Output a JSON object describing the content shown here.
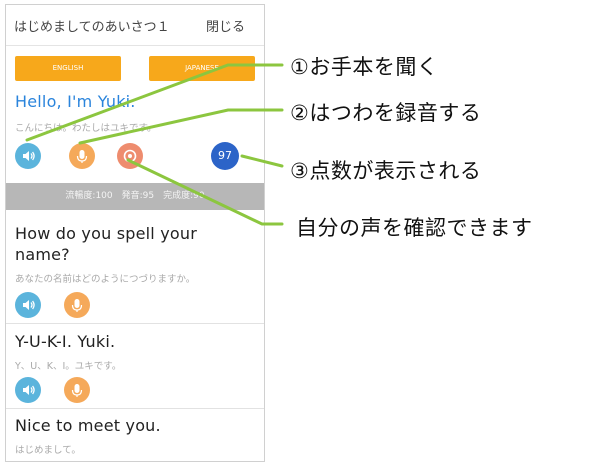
{
  "header": {
    "title": "はじめましてのあいさつ１",
    "close_label": "閉じる"
  },
  "language_buttons": {
    "english": "ENGLISH",
    "japanese": "JAPANESE"
  },
  "lines": [
    {
      "en": "Hello, I'm Yuki.",
      "jp": "こんにちは。わたしはユキです。"
    },
    {
      "en1": "How do you spell your",
      "en2": "name?",
      "jp": "あなたの名前はどのようにつづりますか。"
    },
    {
      "en": "Y-U-K-I. Yuki.",
      "jp": "Y、U、K、I。ユキです。"
    },
    {
      "en": "Nice to meet you.",
      "jp": "はじめまして。"
    }
  ],
  "score": {
    "value": "97"
  },
  "score_bar": {
    "text": "流暢度:100　発音:95　完成度:90"
  },
  "icons": {
    "listen": "speaker-icon",
    "record": "microphone-icon",
    "playback": "replay-icon"
  },
  "colors": {
    "accent": "#f7a81b",
    "highlight_text": "#2a84dc",
    "listen_button": "#5bb4dc",
    "record_button": "#f5a95a",
    "playback_button": "#ee8c6e",
    "score_badge": "#2c64c8",
    "callout_line": "#8cc63f"
  },
  "annotations": [
    "①お手本を聞く",
    "②はつわを録音する",
    "③点数が表示される",
    "自分の声を確認できます"
  ]
}
